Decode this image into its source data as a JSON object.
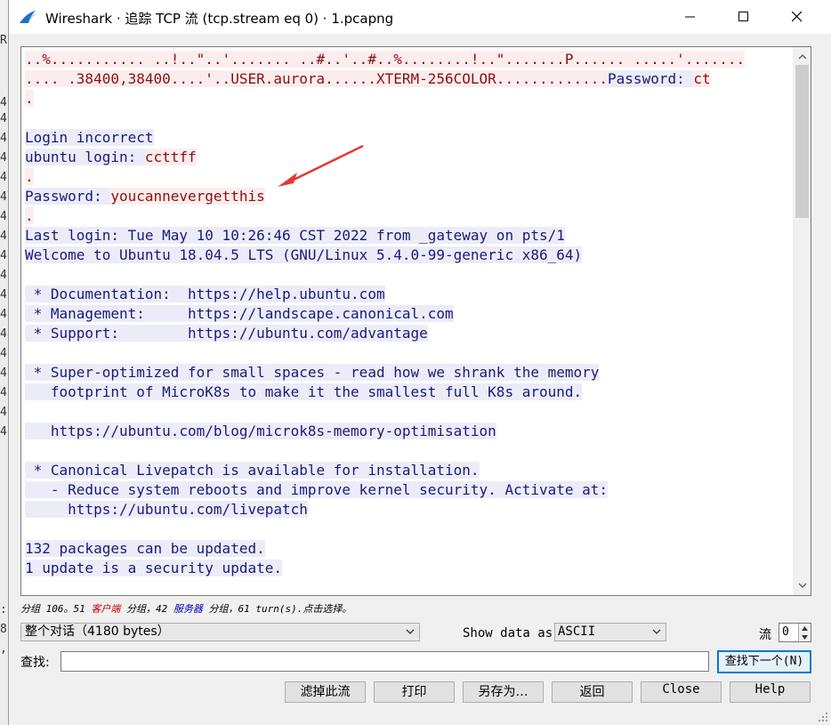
{
  "behind_glyphs": [
    "R",
    "4",
    "4",
    "4",
    "4",
    "4",
    "4",
    "4",
    "4",
    "4",
    "4",
    "4",
    "4",
    "4",
    "4",
    "4",
    "4",
    "4",
    "4",
    ":",
    "8",
    ","
  ],
  "window": {
    "title": "Wireshark · 追踪 TCP 流 (tcp.stream eq 0) · 1.pcapng",
    "app_icon": "wireshark-fin-icon",
    "controls": [
      "minimize-icon",
      "maximize-icon",
      "close-icon"
    ]
  },
  "stream": {
    "lines": [
      [
        {
          "t": "..%........... ..!..\"..'....... ..#..'..#..%........!..\".......P...... .....'.......",
          "k": "c"
        }
      ],
      [
        {
          "t": ".... .38400,38400....'..USER.aurora......XTERM-256COLOR.............",
          "k": "c"
        },
        {
          "t": "Password: ",
          "k": "s"
        },
        {
          "t": "ct",
          "k": "c"
        }
      ],
      [
        {
          "t": ".",
          "k": "c"
        }
      ],
      [
        {
          "t": "",
          "k": "s"
        }
      ],
      [
        {
          "t": "Login incorrect",
          "k": "s"
        }
      ],
      [
        {
          "t": "ubuntu login: ",
          "k": "s"
        },
        {
          "t": "ccttff",
          "k": "c"
        }
      ],
      [
        {
          "t": ".",
          "k": "c"
        }
      ],
      [
        {
          "t": "Password: ",
          "k": "s"
        },
        {
          "t": "youcannevergetthis",
          "k": "c"
        }
      ],
      [
        {
          "t": ".",
          "k": "c"
        }
      ],
      [
        {
          "t": "Last login: Tue May 10 10:26:46 CST 2022 from _gateway on pts/1",
          "k": "s"
        }
      ],
      [
        {
          "t": "Welcome to Ubuntu 18.04.5 LTS (GNU/Linux 5.4.0-99-generic x86_64)",
          "k": "s"
        }
      ],
      [
        {
          "t": "",
          "k": "s"
        }
      ],
      [
        {
          "t": " * Documentation:  https://help.ubuntu.com",
          "k": "s"
        }
      ],
      [
        {
          "t": " * Management:     https://landscape.canonical.com",
          "k": "s"
        }
      ],
      [
        {
          "t": " * Support:        https://ubuntu.com/advantage",
          "k": "s"
        }
      ],
      [
        {
          "t": "",
          "k": "s"
        }
      ],
      [
        {
          "t": " * Super-optimized for small spaces - read how we shrank the memory",
          "k": "s"
        }
      ],
      [
        {
          "t": "   footprint of MicroK8s to make it the smallest full K8s around.",
          "k": "s"
        }
      ],
      [
        {
          "t": "",
          "k": "s"
        }
      ],
      [
        {
          "t": "   https://ubuntu.com/blog/microk8s-memory-optimisation",
          "k": "s"
        }
      ],
      [
        {
          "t": "",
          "k": "s"
        }
      ],
      [
        {
          "t": " * Canonical Livepatch is available for installation.",
          "k": "s"
        }
      ],
      [
        {
          "t": "   - Reduce system reboots and improve kernel security. Activate at:",
          "k": "s"
        }
      ],
      [
        {
          "t": "     https://ubuntu.com/livepatch",
          "k": "s"
        }
      ],
      [
        {
          "t": "",
          "k": "s"
        }
      ],
      [
        {
          "t": "132 packages can be updated.",
          "k": "s"
        }
      ],
      [
        {
          "t": "1 update is a security update.",
          "k": "s"
        }
      ]
    ],
    "colors": {
      "client_fg": "#8b1010",
      "client_bg": "#fbeded",
      "server_fg": "#1a1a7a",
      "server_bg": "#ececf8"
    }
  },
  "status": {
    "prefix": "分组 106。51 ",
    "client": "客户端",
    "mid": " 分组，42 ",
    "server": "服务器",
    "suffix": " 分组，61 turn(s).点击选择。"
  },
  "controls": {
    "conversation": "整个对话（4180 bytes）",
    "show_as_label": "Show data as",
    "show_as_value": "ASCII",
    "stream_label": "流",
    "stream_value": "0"
  },
  "find": {
    "label": "查找:",
    "value": "",
    "next_label": "查找下一个(N)"
  },
  "buttons": {
    "filter_out": "滤掉此流",
    "print": "打印",
    "save_as": "另存为…",
    "back": "返回",
    "close": "Close",
    "help": "Help"
  },
  "annotation": {
    "arrow_color": "#e53935"
  }
}
